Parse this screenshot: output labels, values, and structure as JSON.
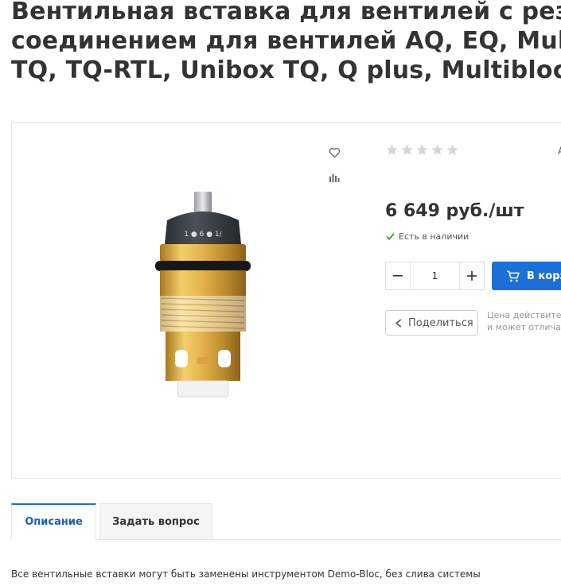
{
  "product": {
    "title_lines": [
      "Вентильная вставка для вентилей с рез",
      "соединением для вентилей AQ, EQ, Mul",
      "TQ, TQ-RTL, Unibox TQ, Q plus, Multiblock"
    ],
    "article_label": "А",
    "rating": {
      "value": 0,
      "max": 5
    },
    "price": "6 649 руб./шт",
    "stock_status": "Есть в наличии",
    "quantity": "1",
    "cart_button": "В корз",
    "share_button": "Поделиться",
    "price_note_lines": [
      "Цена действител",
      "и может отличат"
    ]
  },
  "icons": {
    "favorite": "heart-icon",
    "compare": "bar-chart-icon",
    "check": "check-icon",
    "cart": "cart-icon",
    "share": "share-icon",
    "minus": "minus-icon",
    "plus": "plus-icon"
  },
  "tabs": [
    {
      "label": "Описание",
      "active": true
    },
    {
      "label": "Задать вопрос",
      "active": false
    }
  ],
  "description": "Все вентильные вставки могут быть заменены инструментом Demo-Bloc, без слива системы",
  "colors": {
    "accent": "#1c6fd6",
    "stock_green": "#3aa035",
    "star_gray": "#d6d6d6"
  }
}
